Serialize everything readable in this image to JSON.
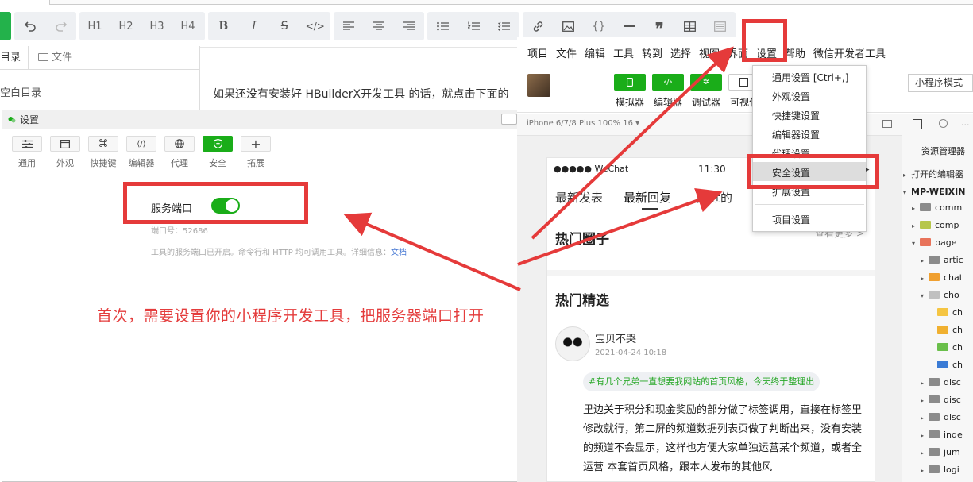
{
  "editor": {
    "heading_buttons": [
      "H1",
      "H2",
      "H3",
      "H4"
    ],
    "left_tabs": {
      "toc": "目录",
      "files": "文件"
    },
    "empty_toc": "空白目录",
    "doc_text": "如果还没有安装好 HBuilderX开发工具 的话，就点击下面的"
  },
  "settings_dialog": {
    "title": "设置",
    "tabs": [
      {
        "label": "通用",
        "icon": "list-icon"
      },
      {
        "label": "外观",
        "icon": "window-icon"
      },
      {
        "label": "快捷键",
        "icon": "command-icon"
      },
      {
        "label": "编辑器",
        "icon": "code-icon"
      },
      {
        "label": "代理",
        "icon": "globe-icon"
      },
      {
        "label": "安全",
        "icon": "shield-icon",
        "active": true
      },
      {
        "label": "拓展",
        "icon": "plus-icon"
      }
    ],
    "service_port_label": "服务端口",
    "service_port_on": true,
    "port_text": "端口号：52686",
    "service_desc": "工具的服务端口已开启。命令行和 HTTP 均可调用工具。详细信息：",
    "service_desc_link": "文档"
  },
  "annotation_caption": "首次，需要设置你的小程序开发工具，把服务器端口打开",
  "ide": {
    "menu": [
      "项目",
      "文件",
      "编辑",
      "工具",
      "转到",
      "选择",
      "视图",
      "界面",
      "设置",
      "帮助",
      "微信开发者工具"
    ],
    "toolbar_buttons": [
      "模拟器",
      "编辑器",
      "调试器",
      "可视化"
    ],
    "mode_select": "小程序模式",
    "simulator_header": "iPhone 6/7/8 Plus 100% 16 ▾",
    "settings_menu": [
      "通用设置 [Ctrl+,]",
      "外观设置",
      "快捷键设置",
      "编辑器设置",
      "代理设置",
      "安全设置",
      "扩展设置",
      "项目设置"
    ],
    "settings_menu_highlighted": "安全设置"
  },
  "phone": {
    "status_left": "●●●●● WeChat",
    "status_time": "11:30",
    "tabs": [
      "最新发表",
      "最新回复",
      "附近的"
    ],
    "section_hot_circles": "热门圈子",
    "more_link": "查看更多 >",
    "section_hot_picks": "热门精选",
    "author": "宝贝不哭",
    "post_time": "2021-04-24 10:18",
    "tag": "#有几个兄弟一直想要我网站的首页风格，今天终于整理出",
    "body": "里边关于积分和现金奖励的部分做了标签调用，直接在标签里修改就行，第二屏的频道数据列表页做了判断出来，没有安装的频道不会显示，这样也方便大家单独运营某个频道，或者全运营 本套首页风格，跟本人发布的其他风"
  },
  "explorer": {
    "title": "资源管理器",
    "open_editors": "打开的编辑器",
    "project": "MP-WEIXIN",
    "rows": [
      {
        "label": "comm",
        "depth": 1,
        "arrow": "▸",
        "color": "#8b8b8b"
      },
      {
        "label": "comp",
        "depth": 1,
        "arrow": "▸",
        "color": "#b6c64a"
      },
      {
        "label": "page",
        "depth": 1,
        "arrow": "▾",
        "color": "#e8735a"
      },
      {
        "label": "artic",
        "depth": 2,
        "arrow": "▸",
        "color": "#8b8b8b"
      },
      {
        "label": "chat",
        "depth": 2,
        "arrow": "▸",
        "color": "#f0a030"
      },
      {
        "label": "cho",
        "depth": 2,
        "arrow": "▾",
        "color": "#c0c0c0"
      },
      {
        "label": "ch",
        "depth": 3,
        "arrow": "",
        "color": "#f5c542"
      },
      {
        "label": "ch",
        "depth": 3,
        "arrow": "",
        "color": "#f0b030"
      },
      {
        "label": "ch",
        "depth": 3,
        "arrow": "",
        "color": "#6abf4b"
      },
      {
        "label": "ch",
        "depth": 3,
        "arrow": "",
        "color": "#3a7bd5"
      },
      {
        "label": "disc",
        "depth": 2,
        "arrow": "▸",
        "color": "#8b8b8b"
      },
      {
        "label": "disc",
        "depth": 2,
        "arrow": "▸",
        "color": "#8b8b8b"
      },
      {
        "label": "disc",
        "depth": 2,
        "arrow": "▸",
        "color": "#8b8b8b"
      },
      {
        "label": "inde",
        "depth": 2,
        "arrow": "▸",
        "color": "#8b8b8b"
      },
      {
        "label": "jum",
        "depth": 2,
        "arrow": "▸",
        "color": "#8b8b8b"
      },
      {
        "label": "logi",
        "depth": 2,
        "arrow": "▸",
        "color": "#8b8b8b"
      }
    ]
  },
  "colors": {
    "annotation_red": "#e53a3a",
    "wechat_green": "#1aad19",
    "toolbar_group_bg": "#eef0f3"
  }
}
